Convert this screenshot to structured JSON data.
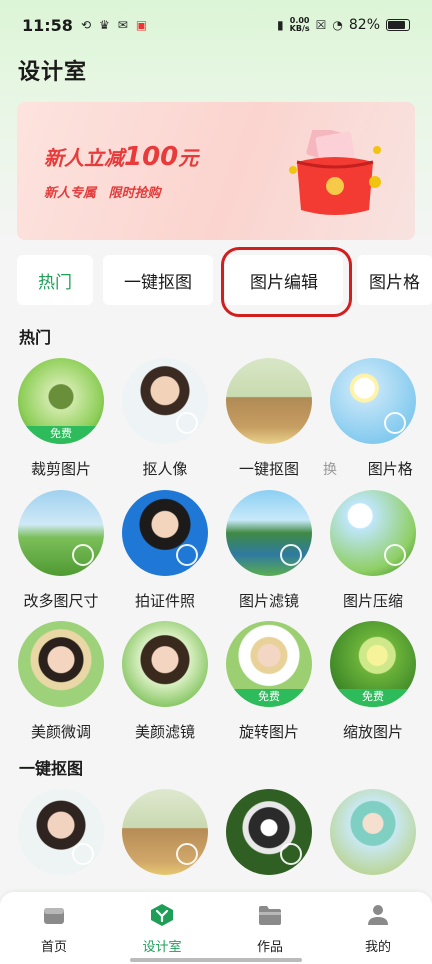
{
  "status_bar": {
    "time": "11:58",
    "speed_top": "0.00",
    "speed_bottom": "KB/s",
    "battery": "82%"
  },
  "page_title": "设计室",
  "banner": {
    "main_prefix": "新人立减",
    "main_amount": "100",
    "main_suffix": "元",
    "sub": "新人专属 限时抢购"
  },
  "tabs": [
    "热门",
    "一键抠图",
    "图片编辑",
    "图片格"
  ],
  "sections": {
    "hot": {
      "title": "热门",
      "items": [
        {
          "label": "裁剪图片",
          "free": "免费"
        },
        {
          "label": "抠人像"
        },
        {
          "label": "一键抠图"
        },
        {
          "label": "图片格"
        },
        {
          "label": "改多图尺寸"
        },
        {
          "label": "拍证件照"
        },
        {
          "label": "图片滤镜"
        },
        {
          "label": "图片压缩"
        },
        {
          "label": "美颜微调"
        },
        {
          "label": "美颜滤镜"
        },
        {
          "label": "旋转图片",
          "free": "免费"
        },
        {
          "label": "缩放图片",
          "free": "免费"
        }
      ],
      "extra_fragment": "换"
    },
    "cutout": {
      "title": "一键抠图"
    }
  },
  "bottom_nav": [
    {
      "label": "首页",
      "icon": "home-icon"
    },
    {
      "label": "设计室",
      "icon": "design-icon"
    },
    {
      "label": "作品",
      "icon": "folder-icon"
    },
    {
      "label": "我的",
      "icon": "profile-icon"
    }
  ],
  "colors": {
    "accent": "#1f9e57",
    "free_badge": "#2dbb5c",
    "banner_red": "#e83a3a",
    "highlight": "#d11f1f"
  }
}
